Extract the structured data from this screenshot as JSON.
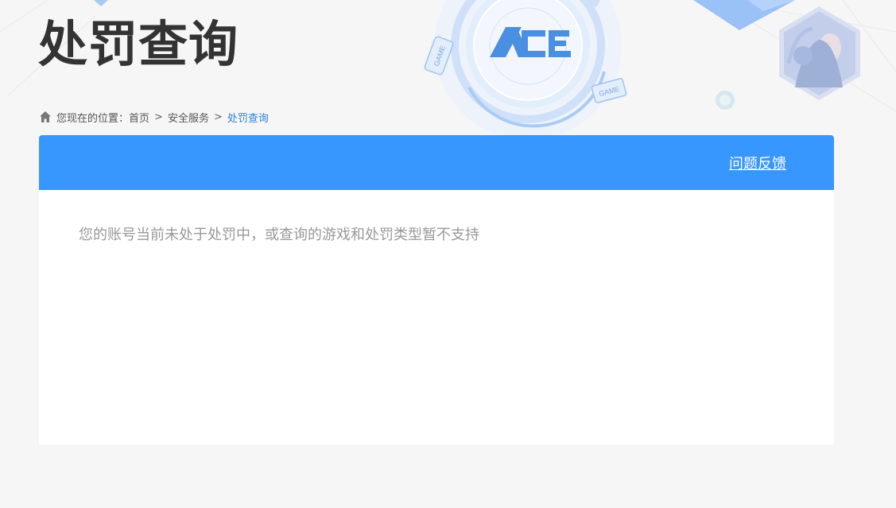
{
  "page": {
    "title": "处罚查询"
  },
  "breadcrumb": {
    "prefix": "您现在的位置：",
    "items": [
      {
        "label": "首页"
      },
      {
        "label": "安全服务"
      }
    ],
    "separator": ">",
    "current": "处罚查询"
  },
  "banner": {
    "logo_text": "ACE",
    "tag_left": "GAME",
    "tag_right": "GAME"
  },
  "panel": {
    "feedback_label": "问题反馈",
    "message": "您的账号当前未处于处罚中，或查询的游戏和处罚类型暂不支持"
  },
  "colors": {
    "accent": "#3897ff",
    "link_current": "#2f82d8",
    "title": "#333333",
    "message": "#999999",
    "background": "#f6f6f6"
  }
}
